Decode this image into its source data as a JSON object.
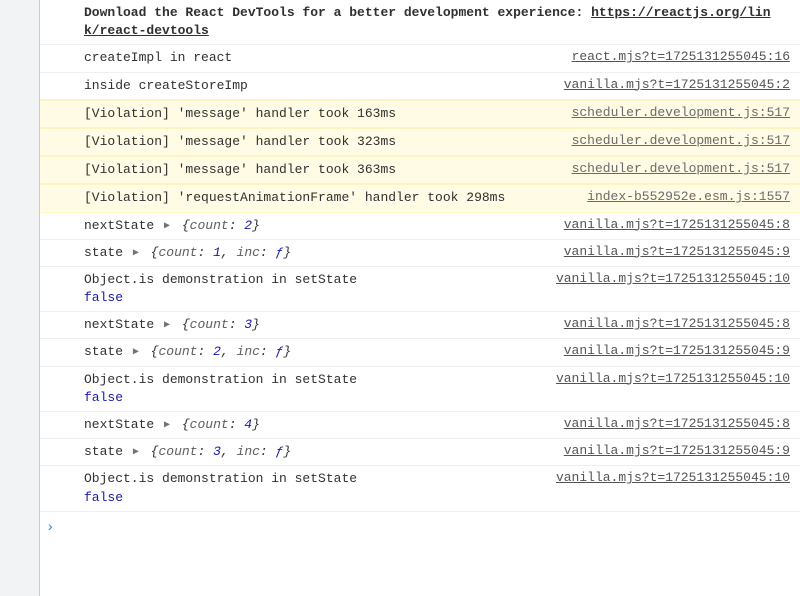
{
  "header": {
    "download_text": "Download the React DevTools for a better development experience: ",
    "download_link": "https://reactjs.org/link/react-devtools"
  },
  "rows": [
    {
      "text": "createImpl in react",
      "src": "react.mjs?t=1725131255045:16"
    },
    {
      "text": "inside createStoreImp",
      "src": "vanilla.mjs?t=1725131255045:2"
    },
    {
      "text": "[Violation] 'message' handler took 163ms",
      "src": "scheduler.development.js:517"
    },
    {
      "text": "[Violation] 'message' handler took 323ms",
      "src": "scheduler.development.js:517"
    },
    {
      "text": "[Violation] 'message' handler took 363ms",
      "src": "scheduler.development.js:517"
    },
    {
      "text": "[Violation] 'requestAnimationFrame' handler took 298ms",
      "src": "index-b552952e.esm.js:1557"
    },
    {
      "label": "nextState ",
      "key1": "count",
      "val1": "2",
      "src": "vanilla.mjs?t=1725131255045:8"
    },
    {
      "label": "state ",
      "key1": "count",
      "val1": "1",
      "key2": "inc",
      "val2": "ƒ",
      "src": "vanilla.mjs?t=1725131255045:9"
    },
    {
      "text": "Object.is demonstration in setState",
      "bool": "false",
      "src": "vanilla.mjs?t=1725131255045:10"
    },
    {
      "label": "nextState ",
      "key1": "count",
      "val1": "3",
      "src": "vanilla.mjs?t=1725131255045:8"
    },
    {
      "label": "state ",
      "key1": "count",
      "val1": "2",
      "key2": "inc",
      "val2": "ƒ",
      "src": "vanilla.mjs?t=1725131255045:9"
    },
    {
      "text": "Object.is demonstration in setState",
      "bool": "false",
      "src": "vanilla.mjs?t=1725131255045:10"
    },
    {
      "label": "nextState ",
      "key1": "count",
      "val1": "4",
      "src": "vanilla.mjs?t=1725131255045:8"
    },
    {
      "label": "state ",
      "key1": "count",
      "val1": "3",
      "key2": "inc",
      "val2": "ƒ",
      "src": "vanilla.mjs?t=1725131255045:9"
    },
    {
      "text": "Object.is demonstration in setState",
      "bool": "false",
      "src": "vanilla.mjs?t=1725131255045:10"
    }
  ]
}
